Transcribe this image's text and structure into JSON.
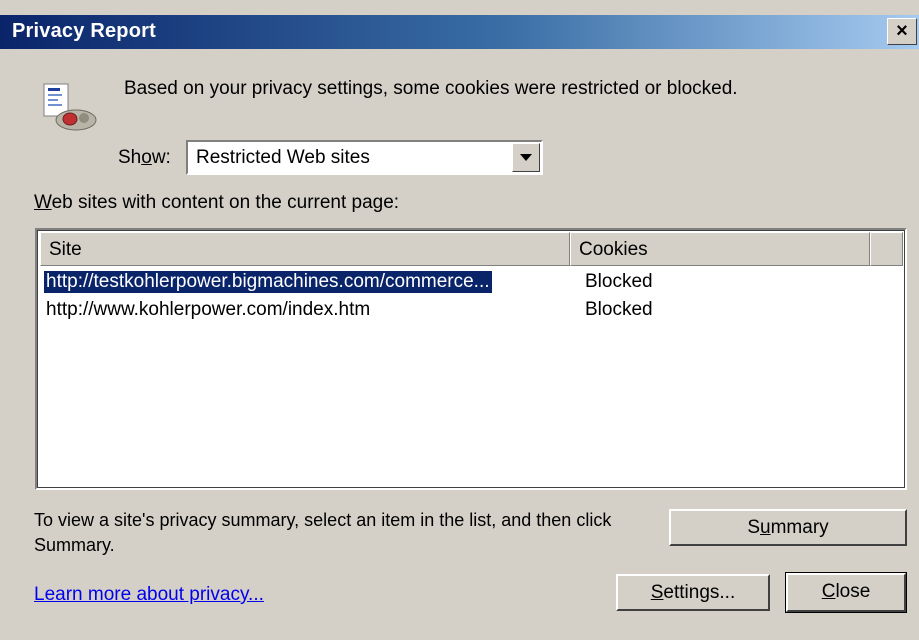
{
  "window": {
    "title": "Privacy Report",
    "close_glyph": "×"
  },
  "header": {
    "icon": "privacy-report-icon",
    "message": "Based on your privacy settings, some cookies were restricted or blocked."
  },
  "show": {
    "label_pre": "Sh",
    "label_accel": "o",
    "label_post": "w:",
    "selected": "Restricted Web sites"
  },
  "list": {
    "label_accel": "W",
    "label_rest": "eb sites with content on the current page:",
    "columns": [
      "Site",
      "Cookies"
    ],
    "rows": [
      {
        "site": "http://testkohlerpower.bigmachines.com/commerce...",
        "cookies": "Blocked",
        "selected": true
      },
      {
        "site": "http://www.kohlerpower.com/index.htm",
        "cookies": "Blocked",
        "selected": false
      }
    ]
  },
  "hint": "To view a site's privacy summary, select an item in the list, and then click Summary.",
  "buttons": {
    "summary_pre": "S",
    "summary_accel": "u",
    "summary_post": "mmary",
    "settings_accel": "S",
    "settings_post": "ettings...",
    "close_accel": "C",
    "close_post": "lose"
  },
  "link": "Learn more about privacy..."
}
